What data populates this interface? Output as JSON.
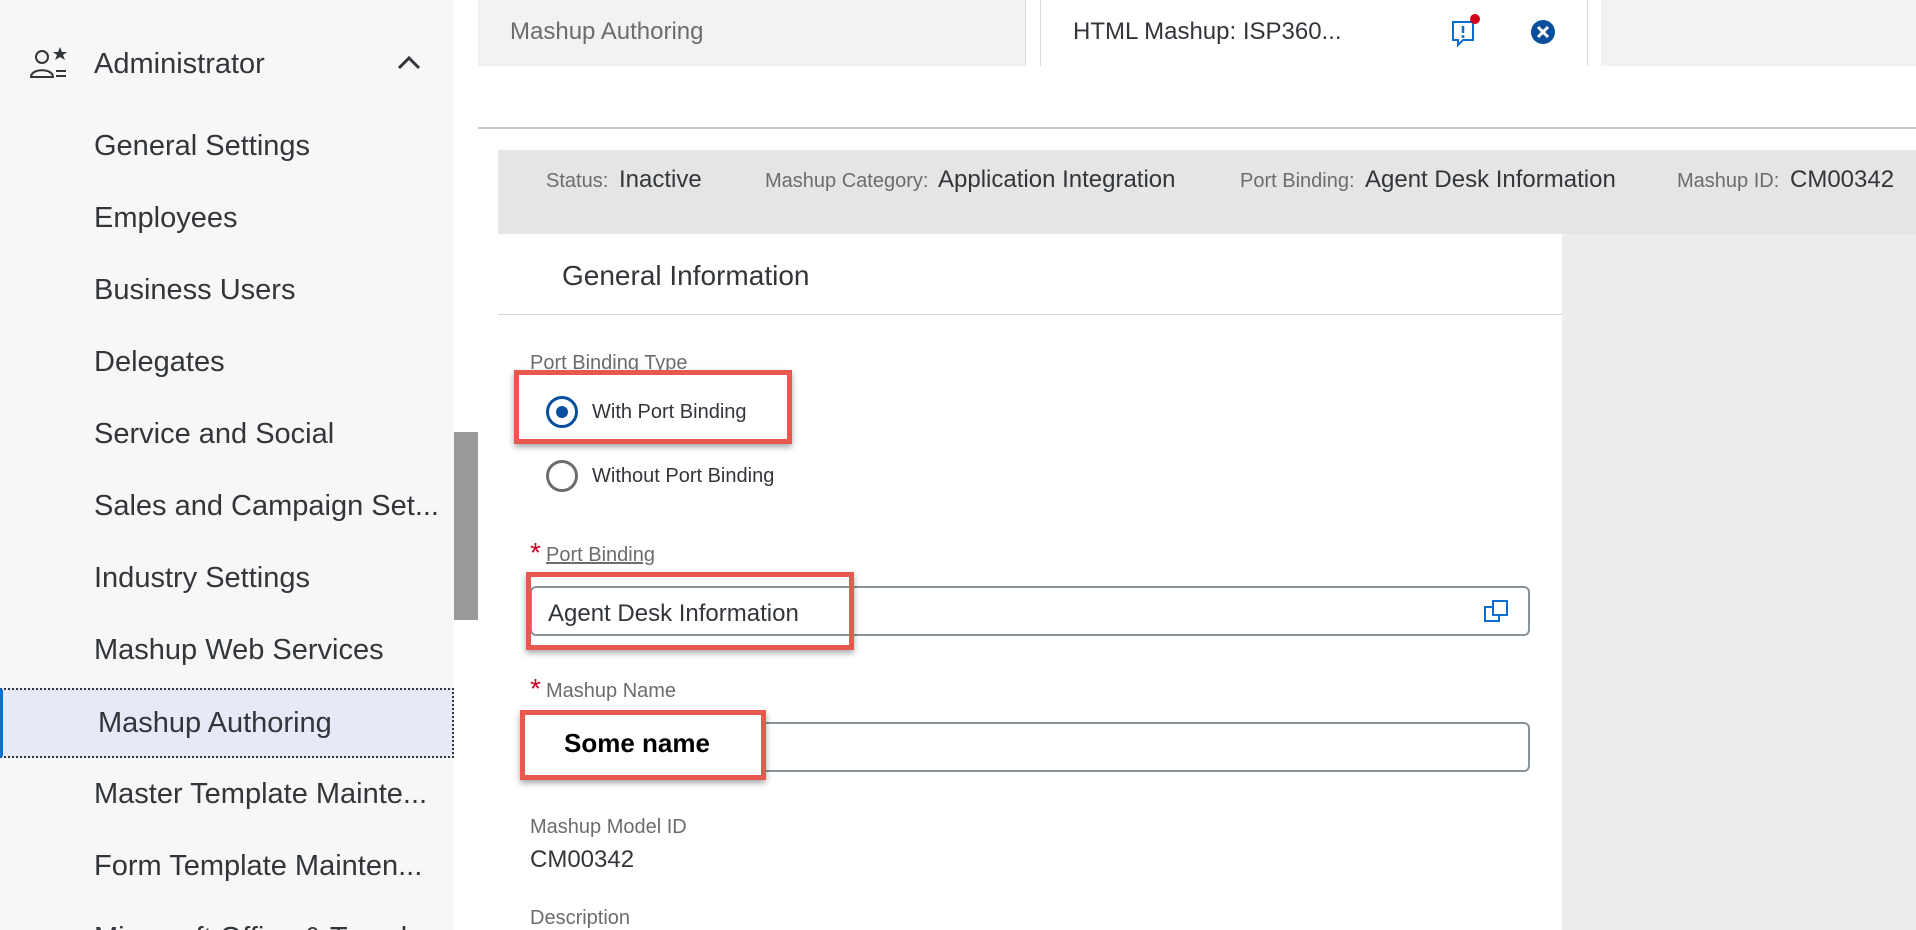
{
  "sidebar": {
    "header": "Administrator",
    "items": [
      {
        "label": "General Settings"
      },
      {
        "label": "Employees"
      },
      {
        "label": "Business Users"
      },
      {
        "label": "Delegates"
      },
      {
        "label": "Service and Social"
      },
      {
        "label": "Sales and Campaign Set..."
      },
      {
        "label": "Industry Settings"
      },
      {
        "label": "Mashup Web Services"
      },
      {
        "label": "Mashup Authoring"
      },
      {
        "label": "Master Template Mainte..."
      },
      {
        "label": "Form Template Mainten..."
      },
      {
        "label": "Microsoft Office & Templ..."
      }
    ]
  },
  "tabs": {
    "inactive": "Mashup Authoring",
    "active": "HTML Mashup: ISP360..."
  },
  "status": {
    "status_label": "Status:",
    "status_value": "Inactive",
    "category_label": "Mashup Category:",
    "category_value": "Application Integration",
    "port_label": "Port Binding:",
    "port_value": "Agent Desk Information",
    "id_label": "Mashup ID:",
    "id_value": "CM00342"
  },
  "form": {
    "section_title": "General Information",
    "port_binding_type_label": "Port Binding Type",
    "radio_with": "With Port Binding",
    "radio_without": "Without Port Binding",
    "radio_selected": "With Port Binding",
    "required_mark": "*",
    "port_binding_label": "Port Binding",
    "port_binding_value": "Agent Desk Information",
    "mashup_name_label": "Mashup Name",
    "mashup_name_value": "Some name",
    "model_id_label": "Mashup Model ID",
    "model_id_value": "CM00342",
    "description_label": "Description"
  },
  "colors": {
    "accent": "#0a6ed1",
    "highlight": "#e8584e",
    "required": "#d0021b",
    "sidebar_active_bg": "#e5eaf6"
  }
}
